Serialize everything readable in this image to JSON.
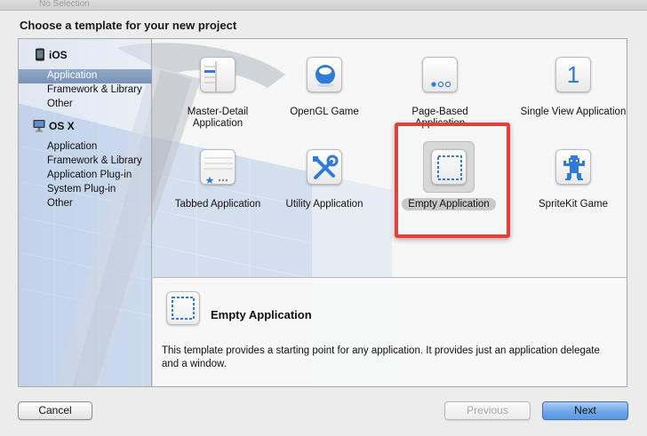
{
  "window": {
    "title": "No Selection"
  },
  "heading": "Choose a template for your new project",
  "sidebar": {
    "groups": [
      {
        "label": "iOS",
        "icon": "iphone-icon",
        "items": [
          "Application",
          "Framework & Library",
          "Other"
        ]
      },
      {
        "label": "OS X",
        "icon": "mac-icon",
        "items": [
          "Application",
          "Framework & Library",
          "Application Plug-in",
          "System Plug-in",
          "Other"
        ]
      }
    ],
    "selected": "iOS / Application"
  },
  "templates": [
    {
      "label": "Master-Detail Application",
      "icon": "master-detail-icon"
    },
    {
      "label": "OpenGL Game",
      "icon": "opengl-icon"
    },
    {
      "label": "Page-Based Application",
      "icon": "page-based-icon"
    },
    {
      "label": "Single View Application",
      "icon": "single-view-icon",
      "glyph": "1"
    },
    {
      "label": "Tabbed Application",
      "icon": "tabbed-icon"
    },
    {
      "label": "Utility Application",
      "icon": "utility-icon"
    },
    {
      "label": "Empty Application",
      "icon": "empty-app-icon",
      "selected": true
    },
    {
      "label": "SpriteKit Game",
      "icon": "spritekit-icon"
    }
  ],
  "description": {
    "title": "Empty Application",
    "text": "This template provides a starting point for any application. It provides just an application delegate and a window."
  },
  "buttons": {
    "cancel": "Cancel",
    "previous": "Previous",
    "next": "Next"
  },
  "colors": {
    "accent": "#2f7bd9",
    "highlight": "#e0413b",
    "selection": "#8fa6c6"
  }
}
